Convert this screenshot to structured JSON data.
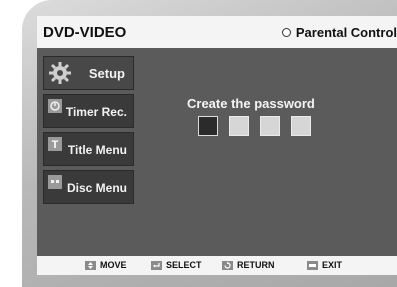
{
  "header": {
    "title": "DVD-VIDEO",
    "section": "Parental Control"
  },
  "sidebar": {
    "items": [
      {
        "label": "Setup",
        "icon": "gear-icon",
        "active": true
      },
      {
        "label": "Timer Rec.",
        "icon": "timer-icon",
        "active": false
      },
      {
        "label": "Title Menu",
        "icon": "title-icon",
        "active": false
      },
      {
        "label": "Disc Menu",
        "icon": "disc-icon",
        "active": false
      }
    ]
  },
  "main": {
    "title": "Create the password",
    "password_digits": 4,
    "filled_digits": 1
  },
  "footer": {
    "move": "MOVE",
    "select": "SELECT",
    "return": "RETURN",
    "exit": "EXIT"
  },
  "colors": {
    "screen_bg": "#5b5b5b",
    "menu_bg": "#3a3a3a",
    "bar_bg": "#f4f4f4"
  }
}
